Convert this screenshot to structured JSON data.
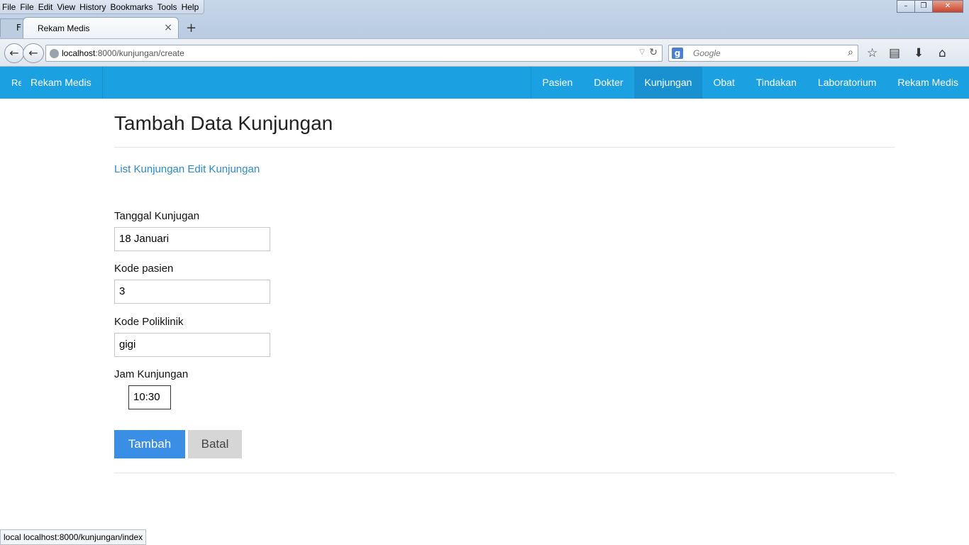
{
  "browser": {
    "menu": [
      "File",
      "Edit",
      "View",
      "History",
      "Bookmarks",
      "Tools",
      "Help"
    ],
    "menu_first_cut": "File",
    "tab_prev_label": "F",
    "tab_title": "Rekam Medis",
    "tab_close": "×",
    "new_tab": "+",
    "url_host": "localhost",
    "url_rest": ":8000/kunjungan/create",
    "search_placeholder": "Google",
    "search_engine_letter": "g",
    "window_controls": [
      "–",
      "❐",
      "✕"
    ]
  },
  "app_nav": {
    "brand_cut": "Re",
    "brand": "Rekam Medis",
    "items": [
      {
        "label": "Pasien",
        "active": false
      },
      {
        "label": "Dokter",
        "active": false
      },
      {
        "label": "Kunjungan",
        "active": true
      },
      {
        "label": "Obat",
        "active": false
      },
      {
        "label": "Tindakan",
        "active": false
      },
      {
        "label": "Laboratorium",
        "active": false
      },
      {
        "label": "Rekam Medis",
        "active": false
      }
    ]
  },
  "page": {
    "title": "Tambah Data Kunjungan",
    "link_list": "List Kunjungan",
    "link_edit": "Edit Kunjungan"
  },
  "form": {
    "tanggal_label": "Tanggal Kunjugan",
    "tanggal_value": "18 Januari",
    "pasien_label": "Kode pasien",
    "pasien_value": "3",
    "poli_label": "Kode Poliklinik",
    "poli_value": "gigi",
    "jam_label": "Jam Kunjungan",
    "jam_value": "10:30",
    "submit_label": "Tambah",
    "cancel_label": "Batal"
  },
  "status_bar": "local localhost:8000/kunjungan/index"
}
